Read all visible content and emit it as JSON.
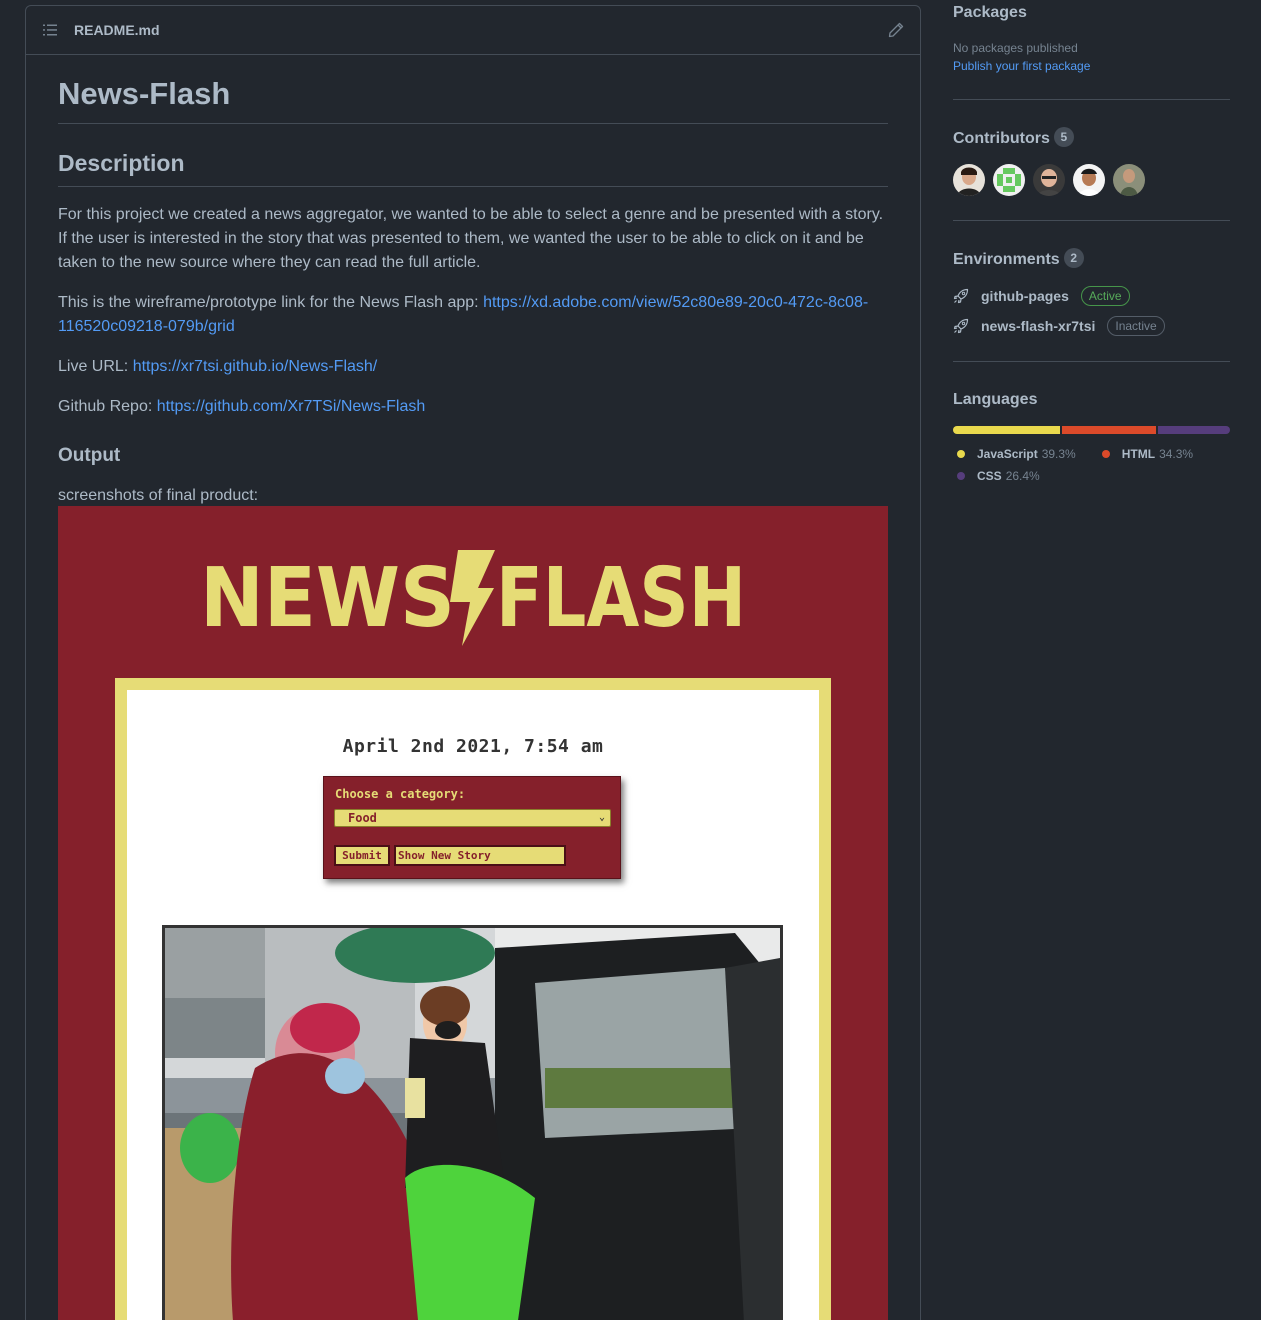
{
  "readme": {
    "filename": "README.md",
    "title": "News-Flash",
    "description_heading": "Description",
    "description": "For this project we created a news aggregator, we wanted to be able to select a genre and be presented with a story. If the user is interested in the story that was presented to them, we wanted the user to be able to click on it and be taken to the new source where they can read the full article.",
    "wireframe_prefix": "This is the wireframe/prototype link for the News Flash app: ",
    "wireframe_link": "https://xd.adobe.com/view/52c80e89-20c0-472c-8c08-116520c09218-079b/grid",
    "live_prefix": "Live URL: ",
    "live_link": "https://xr7tsi.github.io/News-Flash/",
    "repo_prefix": "Github Repo: ",
    "repo_link": "https://github.com/Xr7TSi/News-Flash",
    "output_heading": "Output",
    "screenshots_text": "screenshots of final product:"
  },
  "app_screenshot": {
    "logo_left": "NEWS",
    "logo_right": "FLASH",
    "date": "April 2nd 2021, 7:54 am",
    "form_label": "Choose a category:",
    "selected_category": "Food",
    "submit_label": "Submit",
    "show_story_label": "Show New Story"
  },
  "sidebar": {
    "packages": {
      "heading": "Packages",
      "none_text": "No packages published",
      "publish_link": "Publish your first package"
    },
    "contributors": {
      "heading": "Contributors",
      "count": "5"
    },
    "environments": {
      "heading": "Environments",
      "count": "2",
      "items": [
        {
          "name": "github-pages",
          "status": "Active"
        },
        {
          "name": "news-flash-xr7tsi",
          "status": "Inactive"
        }
      ]
    },
    "languages": {
      "heading": "Languages",
      "items": [
        {
          "name": "JavaScript",
          "percent": "39.3%",
          "value": 39.3,
          "color": "#e9d94d"
        },
        {
          "name": "HTML",
          "percent": "34.3%",
          "value": 34.3,
          "color": "#dc4a2a"
        },
        {
          "name": "CSS",
          "percent": "26.4%",
          "value": 26.4,
          "color": "#563d7c"
        }
      ]
    }
  },
  "colors": {
    "background": "#22272e",
    "border": "#444c56",
    "text": "#adbac7",
    "link": "#539bf5",
    "app_red": "#85202b",
    "app_yellow": "#e6dc76"
  }
}
